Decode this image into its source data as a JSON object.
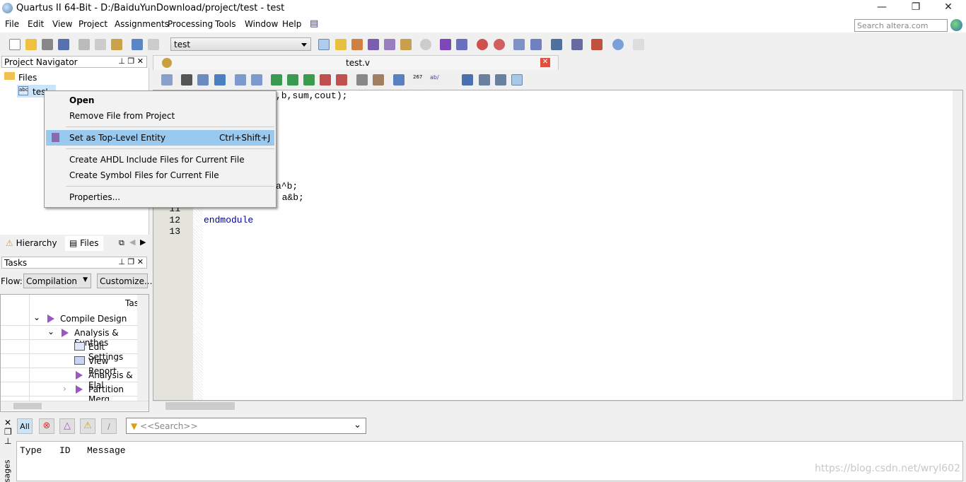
{
  "window": {
    "title": "Quartus II 64-Bit - D:/BaiduYunDownload/project/test - test",
    "minimize": "—",
    "restore": "❐",
    "close": "✕"
  },
  "menubar": [
    "File",
    "Edit",
    "View",
    "Project",
    "Assignments",
    "Processing",
    "Tools",
    "Window",
    "Help"
  ],
  "search": {
    "placeholder": "Search altera.com"
  },
  "toolbar": {
    "entity_combo": "test"
  },
  "project_navigator": {
    "title": "Project Navigator",
    "root": "Files",
    "file": "test.v",
    "file_visible": "tes'"
  },
  "nav_tabs": [
    "Hierarchy",
    "Files"
  ],
  "tasks": {
    "title": "Tasks",
    "flow_label": "Flow:",
    "flow_value": "Compilation",
    "customize": "Customize...",
    "column": "Tas",
    "rows": [
      {
        "label": "Compile Design"
      },
      {
        "label": "Analysis & Synthes"
      },
      {
        "label": "Edit Settings"
      },
      {
        "label": "View Report"
      },
      {
        "label": "Analysis & Elal"
      },
      {
        "label": "Partition Merg"
      }
    ]
  },
  "editor": {
    "tab": "test.v",
    "lines": {
      "l1": ",b,sum,cout);",
      "l9": "a^b;",
      "l10": ": a&b;",
      "n11": "11",
      "n12": "12",
      "l12": "endmodule",
      "n13": "13"
    },
    "keyword_color": "#00008b"
  },
  "context_menu": {
    "items": [
      {
        "label": "Open"
      },
      {
        "label": "Remove File from Project"
      },
      {
        "label": "Set as Top-Level Entity",
        "shortcut": "Ctrl+Shift+J"
      },
      {
        "label": "Create AHDL Include Files for Current File"
      },
      {
        "label": "Create Symbol Files for Current File"
      },
      {
        "label": "Properties..."
      }
    ],
    "highlight": "#99c9ef"
  },
  "messages": {
    "all": "All",
    "search_placeholder": "<<Search>>",
    "columns": [
      "Type",
      "ID",
      "Message"
    ],
    "side_label": "sages"
  },
  "watermark": "https://blog.csdn.net/wryl602"
}
